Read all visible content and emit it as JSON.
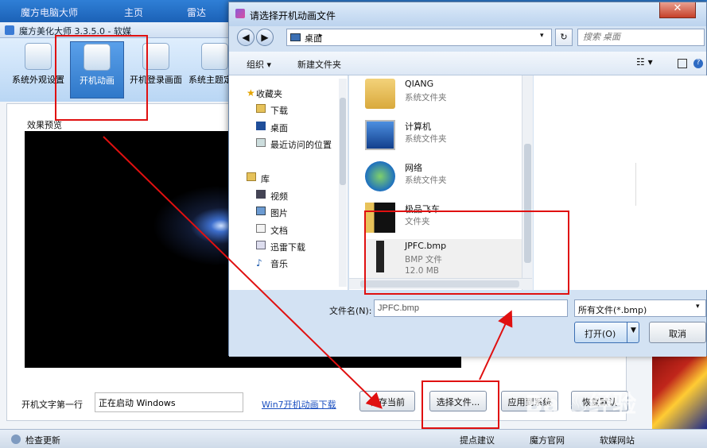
{
  "topbar": {
    "title": "魔方电脑大师",
    "tab_home": "主页",
    "tab_thunder": "雷达"
  },
  "app": {
    "window_title": "魔方美化大师 3.3.5.0 - 软媒",
    "ribbon": [
      {
        "label": "系统外观设置",
        "icon": "paint-brush-icon"
      },
      {
        "label": "开机动画",
        "icon": "windows-logo-icon"
      },
      {
        "label": "开机登录画面",
        "icon": "user-icon"
      },
      {
        "label": "系统主题定制",
        "icon": "tshirt-icon"
      }
    ],
    "preview_label": "效果预览",
    "boot_text_label": "开机文字第一行",
    "boot_text_value": "正在启动 Windows",
    "download_link": "Win7开机动画下载",
    "buttons": {
      "save_current": "保存当前",
      "choose_file": "选择文件...",
      "apply": "应用到系统",
      "restore": "恢复默认"
    },
    "status": {
      "update": "检查更新",
      "suggest": "提点建议",
      "site": "魔方官网",
      "ruanmei": "软媒网站"
    }
  },
  "dialog": {
    "title": "请选择开机动画文件",
    "address": "桌面",
    "search_placeholder": "搜索 桌面",
    "toolbar": {
      "organize": "组织 ▾",
      "new_folder": "新建文件夹"
    },
    "nav": [
      {
        "label": "收藏夹",
        "icon": "star-icon"
      },
      {
        "label": "下载",
        "icon": "download-folder-icon"
      },
      {
        "label": "桌面",
        "icon": "desktop-icon"
      },
      {
        "label": "最近访问的位置",
        "icon": "recent-places-icon"
      },
      {
        "label": "库",
        "icon": "library-icon"
      },
      {
        "label": "视频",
        "icon": "video-icon"
      },
      {
        "label": "图片",
        "icon": "picture-icon"
      },
      {
        "label": "文档",
        "icon": "document-icon"
      },
      {
        "label": "迅雷下载",
        "icon": "thunder-download-icon"
      },
      {
        "label": "音乐",
        "icon": "music-icon"
      }
    ],
    "files": [
      {
        "name": "QIANG",
        "type": "系统文件夹",
        "size": "",
        "icon": "user-folder-icon"
      },
      {
        "name": "计算机",
        "type": "系统文件夹",
        "size": "",
        "icon": "computer-icon"
      },
      {
        "name": "网络",
        "type": "系统文件夹",
        "size": "",
        "icon": "network-icon"
      },
      {
        "name": "极品飞车",
        "type": "文件夹",
        "size": "",
        "icon": "folder-icon"
      },
      {
        "name": "JPFC.bmp",
        "type": "BMP 文件",
        "size": "12.0 MB",
        "icon": "bmp-file-icon"
      }
    ],
    "filename_label": "文件名(N):",
    "filename_value": "JPFC.bmp",
    "filetype": "所有文件(*.bmp)",
    "open_label": "打开(O)",
    "cancel_label": "取消"
  },
  "watermark": "Bai♨经验"
}
